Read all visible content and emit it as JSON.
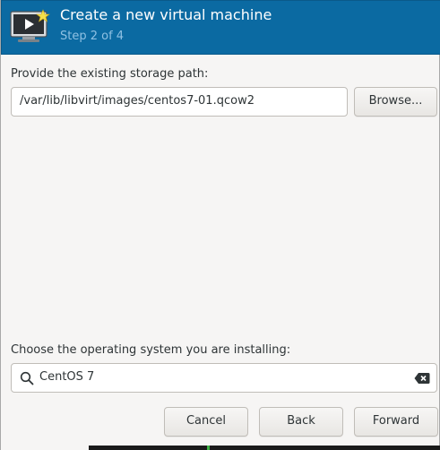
{
  "header": {
    "title": "Create a new virtual machine",
    "subtitle": "Step 2 of 4",
    "icon": "virtual-machine-new-icon",
    "background": "#0b6aa2"
  },
  "storage": {
    "label": "Provide the existing storage path:",
    "path_value": "/var/lib/libvirt/images/centos7-01.qcow2",
    "browse_label": "Browse..."
  },
  "os": {
    "label": "Choose the operating system you are installing:",
    "search_value": "CentOS 7",
    "search_icon": "search-icon",
    "clear_icon": "clear-text-icon"
  },
  "footer": {
    "cancel_label": "Cancel",
    "back_label": "Back",
    "forward_label": "Forward"
  }
}
